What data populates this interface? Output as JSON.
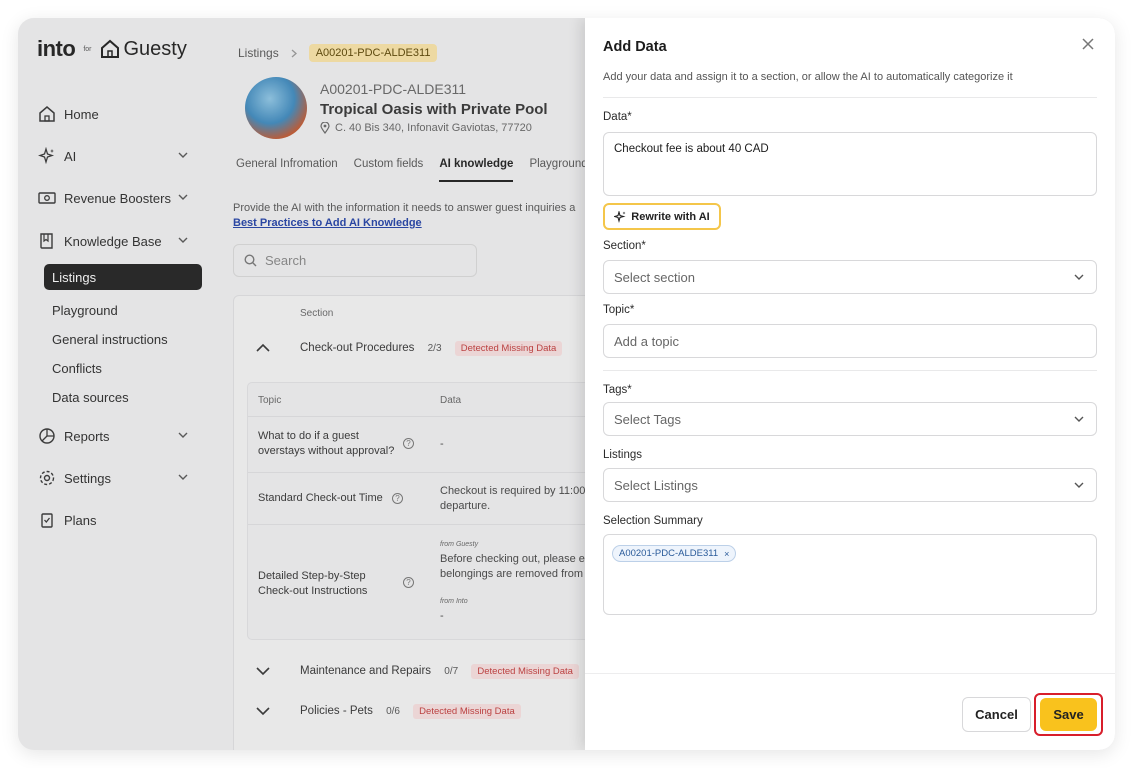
{
  "app": {
    "logo_into": "into",
    "logo_for": "for",
    "logo_guesty": "Guesty"
  },
  "sidebar": {
    "items": [
      {
        "label": "Home",
        "icon": "home-icon"
      },
      {
        "label": "AI",
        "icon": "sparkles-icon"
      },
      {
        "label": "Revenue Boosters",
        "icon": "money-icon"
      },
      {
        "label": "Knowledge Base",
        "icon": "book-icon"
      },
      {
        "label": "Reports",
        "icon": "pie-chart-icon"
      },
      {
        "label": "Settings",
        "icon": "gear-icon"
      },
      {
        "label": "Plans",
        "icon": "clipboard-icon"
      }
    ],
    "knowledge_sub": [
      "Listings",
      "Playground",
      "General instructions",
      "Conflicts",
      "Data sources"
    ]
  },
  "main": {
    "breadcrumb": {
      "root": "Listings",
      "current": "A00201-PDC-ALDE311"
    },
    "listing": {
      "code": "A00201-PDC-ALDE311",
      "name": "Tropical Oasis with Private Pool",
      "address": "C. 40 Bis 340, Infonavit Gaviotas, 77720"
    },
    "tabs": [
      "General Infromation",
      "Custom fields",
      "AI knowledge",
      "Playground"
    ],
    "intro_text": "Provide the AI with the information it needs to answer guest inquiries a",
    "intro_link": "Best Practices to Add AI Knowledge",
    "search_placeholder": "Search",
    "table": {
      "section_header": "Section",
      "topic_header": "Topic",
      "data_header": "Data",
      "sections": [
        {
          "name": "Check-out Procedures",
          "count": "2/3",
          "badge": "Detected Missing Data"
        },
        {
          "name": "Maintenance and Repairs",
          "count": "0/7",
          "badge": "Detected Missing Data"
        },
        {
          "name": "Policies - Pets",
          "count": "0/6",
          "badge": "Detected Missing Data"
        }
      ],
      "rows": [
        {
          "topic": "What to do if a guest overstays without approval?",
          "data": "-"
        },
        {
          "topic": "Standard Check-out Time",
          "data_line1": "Checkout is required by 11:00",
          "data_line2": "departure."
        },
        {
          "topic": "Detailed Step-by-Step Check-out Instructions",
          "from_guesty": "from Guesty",
          "data_line1": "Before checking out, please e",
          "data_line2": "belongings are removed from",
          "from_into": "from Into",
          "data_into": "-"
        }
      ]
    }
  },
  "panel": {
    "title": "Add Data",
    "subtitle": "Add your data and assign it to a section, or allow the AI to automatically categorize it",
    "data_label": "Data*",
    "data_value": "Checkout fee is about 40 CAD",
    "rewrite_label": "Rewrite with AI",
    "section_label": "Section*",
    "section_placeholder": "Select section",
    "topic_label": "Topic*",
    "topic_placeholder": "Add a topic",
    "tags_label": "Tags*",
    "tags_placeholder": "Select Tags",
    "listings_label": "Listings",
    "listings_placeholder": "Select Listings",
    "summary_label": "Selection Summary",
    "summary_chip": "A00201-PDC-ALDE311",
    "chip_remove": "×",
    "cancel_label": "Cancel",
    "save_label": "Save"
  },
  "colors": {
    "accent_yellow": "#f9c21d",
    "save_highlight": "#d81e2b",
    "active_nav": "#1e1e1e",
    "missing_badge_text": "#c43a3a",
    "link_blue": "#1f3fa8"
  }
}
